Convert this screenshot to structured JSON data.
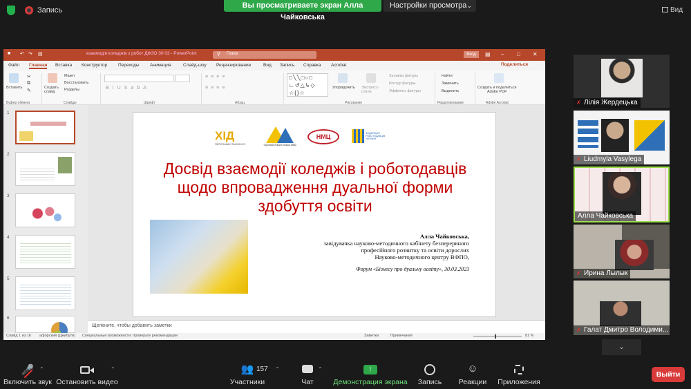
{
  "topbar": {
    "recording_label": "Запись",
    "sharing_banner": "Вы просматриваете экран Алла Чайковська",
    "view_options_label": "Настройки просмотра",
    "view_label": "Вид"
  },
  "ppt": {
    "title": "взаємодія коледжів з робот ДФЗО 30 03  -  PowerPoint",
    "search_placeholder": "Поиск",
    "signin_label": "Вход",
    "share_label": "Поделиться",
    "tabs": [
      "Файл",
      "Главная",
      "Вставка",
      "Конструктор",
      "Переходы",
      "Анимация",
      "Слайд-шоу",
      "Рецензирование",
      "Вид",
      "Запись",
      "Справка",
      "Acrobat"
    ],
    "ribbon": {
      "paste": "Вставить",
      "create_slide": "Создать\nслайд",
      "layout": "Макет",
      "reset": "Восстановить",
      "sections": "Разделы",
      "arrange": "Упорядочить",
      "express_styles": "Экспресс-\nстили",
      "shape_fill": "Заливка фигуры",
      "shape_outline": "Контур фигуры",
      "shape_effects": "Эффекты фигуры",
      "find": "Найти",
      "replace": "Заменить",
      "select": "Выделить",
      "create_pdf": "Создать и поделиться\nAdobe PDF",
      "groups": [
        "Буфер обмена",
        "Слайды",
        "Шрифт",
        "Абзац",
        "Рисование",
        "Редактирование",
        "Adobe Acrobat"
      ]
    },
    "slide_numbers": [
      "1",
      "2",
      "3",
      "4",
      "5",
      "6"
    ],
    "notes_placeholder": "Щелкните, чтобы добавить заметки",
    "status": {
      "slide": "Слайд 1 из 16",
      "language": "афорский (Джибути)",
      "accessibility": "Специальные возможности: проверьте рекомендации",
      "notes": "Заметки",
      "comments": "Примечания",
      "zoom": "81 %"
    }
  },
  "slide": {
    "logos": [
      "ХІД",
      "ПЕРЕЗАВАНТАЖЕННЯ",
      "НМЦ",
      "ФЕДЕРАЦІЯ\nРОБОТОДАВЦІВ\nУКРАЇНИ",
      "Торговий Альянс МаршТайм"
    ],
    "title_lines": [
      "Досвід взаємодії коледжів і роботодавців",
      "щодо впровадження дуальної форми",
      "здобуття освіти"
    ],
    "author": "Алла Чайковська,",
    "position_lines": [
      "завідувачка науково-методичного кабінету безперервного",
      "професійного розвитку та освіти дорослих",
      "Науково-методичного центру ВФПО,"
    ],
    "event": "Форум «Бізнесу про дуальну освіту»,  30.03.2023"
  },
  "participants": [
    {
      "name": "Лілія Жердецька",
      "muted": true
    },
    {
      "name": "Liudmyla Vasylega",
      "muted": true
    },
    {
      "name": "Алла Чайковська",
      "muted": false
    },
    {
      "name": "Ирина Лылык",
      "muted": true
    },
    {
      "name": "Галат Дмитро Володими...",
      "muted": true
    }
  ],
  "bottombar": {
    "unmute": "Включить звук",
    "video": "Остановить видео",
    "participants": "Участники",
    "participants_count": "157",
    "chat": "Чат",
    "share": "Демонстрация экрана",
    "record": "Запись",
    "reactions": "Реакции",
    "apps": "Приложения",
    "exit": "Выйти"
  },
  "colors": {
    "zoom_green": "#2fa84a",
    "ppt_red": "#b7472a",
    "slide_title": "#c00000",
    "exit_red": "#d93a3a",
    "active_speaker": "#9ce04a"
  }
}
